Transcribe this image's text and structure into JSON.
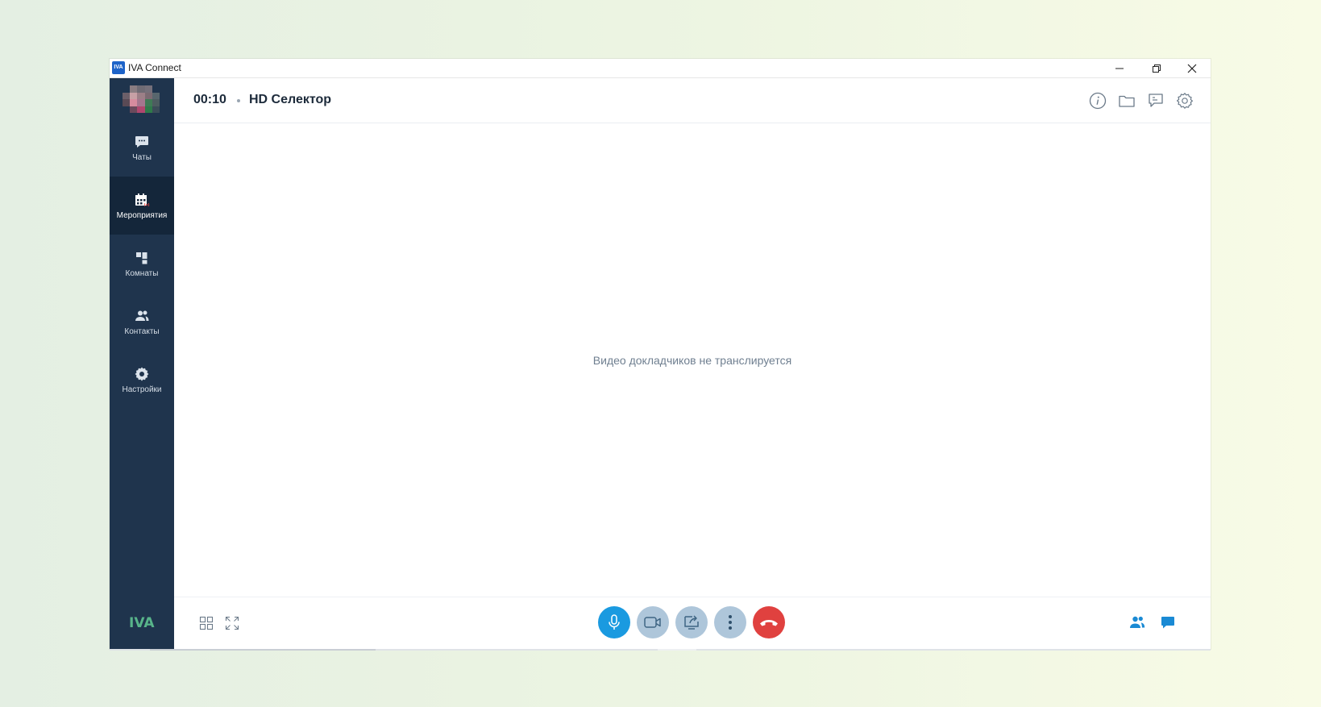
{
  "window": {
    "app_icon_text": "IVA",
    "title": "IVA Connect"
  },
  "sidebar": {
    "items": [
      {
        "label": "Чаты",
        "icon": "chat-icon"
      },
      {
        "label": "Мероприятия",
        "icon": "calendar-live-icon",
        "active": true
      },
      {
        "label": "Комнаты",
        "icon": "rooms-icon"
      },
      {
        "label": "Контакты",
        "icon": "contacts-icon"
      },
      {
        "label": "Настройки",
        "icon": "settings-gear-icon"
      }
    ],
    "logo_text": "IVA"
  },
  "call": {
    "timer": "00:10",
    "conference_name": "HD Селектор",
    "stage_message": "Видео докладчиков не транслируется"
  },
  "header_icons": [
    "info-icon",
    "folder-icon",
    "notes-icon",
    "settings-icon"
  ],
  "controls": {
    "mic_state": "on",
    "camera_state": "off",
    "colors": {
      "accent": "#1a9ae0",
      "inactive": "#aec6da",
      "hangup": "#e0413f",
      "sidebar": "#1f344d",
      "sidebar_active": "#14263a"
    }
  }
}
